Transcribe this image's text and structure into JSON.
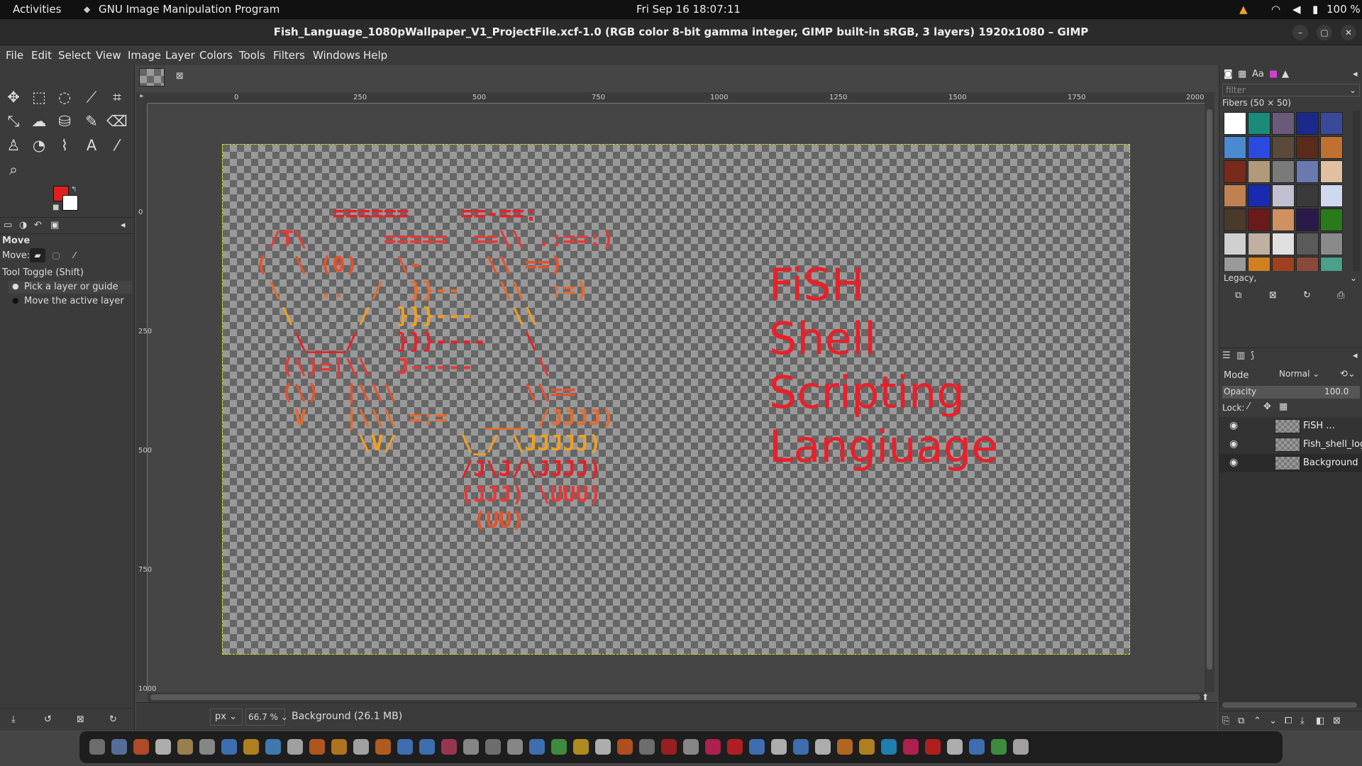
{
  "topbar": {
    "activities": "Activities",
    "app_name": "GNU Image Manipulation Program",
    "clock": "Fri Sep 16  18:07:11",
    "battery": "100 %"
  },
  "window": {
    "title": "Fish_Language_1080pWallpaper_V1_ProjectFile.xcf-1.0 (RGB color 8-bit gamma integer, GIMP built-in sRGB, 3 layers) 1920x1080 – GIMP"
  },
  "menu": [
    "File",
    "Edit",
    "Select",
    "View",
    "Image",
    "Layer",
    "Colors",
    "Tools",
    "Filters",
    "Windows",
    "Help"
  ],
  "tool_options": {
    "tool_name": "Move",
    "move_label": "Move:",
    "toggle_label": "Tool Toggle  (Shift)",
    "radio_pick": "Pick a layer or guide",
    "radio_move": "Move the active layer"
  },
  "ruler": {
    "h_labels": [
      "0",
      "250",
      "500",
      "750",
      "1000",
      "1250",
      "1500",
      "1750",
      "2000"
    ],
    "v_labels": [
      "0",
      "250",
      "500",
      "750",
      "1000"
    ]
  },
  "canvas_text": {
    "line1": "FiSH",
    "line2": "Shell",
    "line3": "Scripting",
    "line4": "Langiuage"
  },
  "ascii_art": {
    "rows": [
      "       ======    ==-==:",
      "  /T\\      =====  ==\\\\ .:==:)",
      " (  \\ (0)   \\-     \\\\ ==)",
      "  \\   ..  /  }}--   \\\\  :=)",
      "   \\     /  }}}---   \\\\",
      "    \\___/   }}}----   \\",
      "   (\\)=|\\\\  J-----     \\",
      "   (\\)  |\\\\\\          \\\\==",
      "    V   |\\\\\\ =:=   ___ /JJJJ)",
      "         \\V/     \\_/ \\JJJJJ)",
      "                 /J\\J/\\JJJJ)",
      "                 (JJJ) \\UUU)",
      "                  (UU)"
    ]
  },
  "statusbar": {
    "unit": "px",
    "zoom": "66.7 %",
    "layer_info": "Background (26.1 MB)"
  },
  "brushes": {
    "filter_placeholder": "filter",
    "pattern_name": "Fibers (50 × 50)",
    "tag": "Legacy,"
  },
  "layers": {
    "mode_label": "Mode",
    "mode_value": "Normal",
    "opacity_label": "Opacity",
    "opacity_value": "100.0",
    "lock_label": "Lock:",
    "items": [
      {
        "name": "FiSH ..."
      },
      {
        "name": "Fish_shell_logo"
      },
      {
        "name": "Background"
      }
    ]
  },
  "colors": {
    "fg": "#e02020",
    "bg": "#ffffff",
    "text_red": "#e8202a",
    "accent_orange": "#f0a020"
  }
}
